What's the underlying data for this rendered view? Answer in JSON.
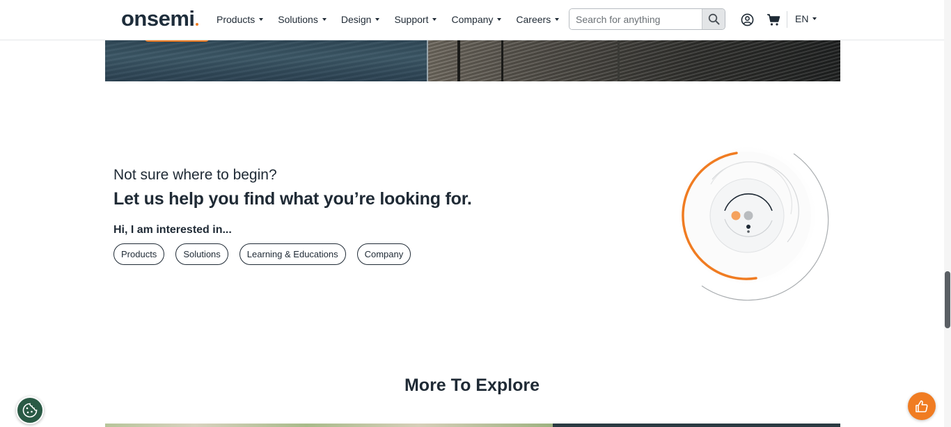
{
  "header": {
    "logo_text": "onsemi",
    "nav": [
      {
        "label": "Products"
      },
      {
        "label": "Solutions"
      },
      {
        "label": "Design"
      },
      {
        "label": "Support"
      },
      {
        "label": "Company"
      },
      {
        "label": "Careers"
      }
    ],
    "search": {
      "placeholder": "Search for anything"
    },
    "language": "EN",
    "icons": [
      "search-icon",
      "account-icon",
      "cart-icon",
      "caret-down-icon"
    ]
  },
  "help": {
    "question": "Not sure where to begin?",
    "title": "Let us help you find what you’re looking for.",
    "interest_label": "Hi, I am interested in...",
    "chips": [
      {
        "label": "Products"
      },
      {
        "label": "Solutions"
      },
      {
        "label": "Learning & Educations"
      },
      {
        "label": "Company"
      }
    ]
  },
  "explore": {
    "title": "More To Explore"
  },
  "floating": {
    "cookie_icon": "cookie-icon",
    "feedback_icon": "thumbs-up-icon"
  },
  "colors": {
    "accent": "#f07c22",
    "text": "#1f2a35",
    "cookie_bg": "#2a5a45"
  }
}
